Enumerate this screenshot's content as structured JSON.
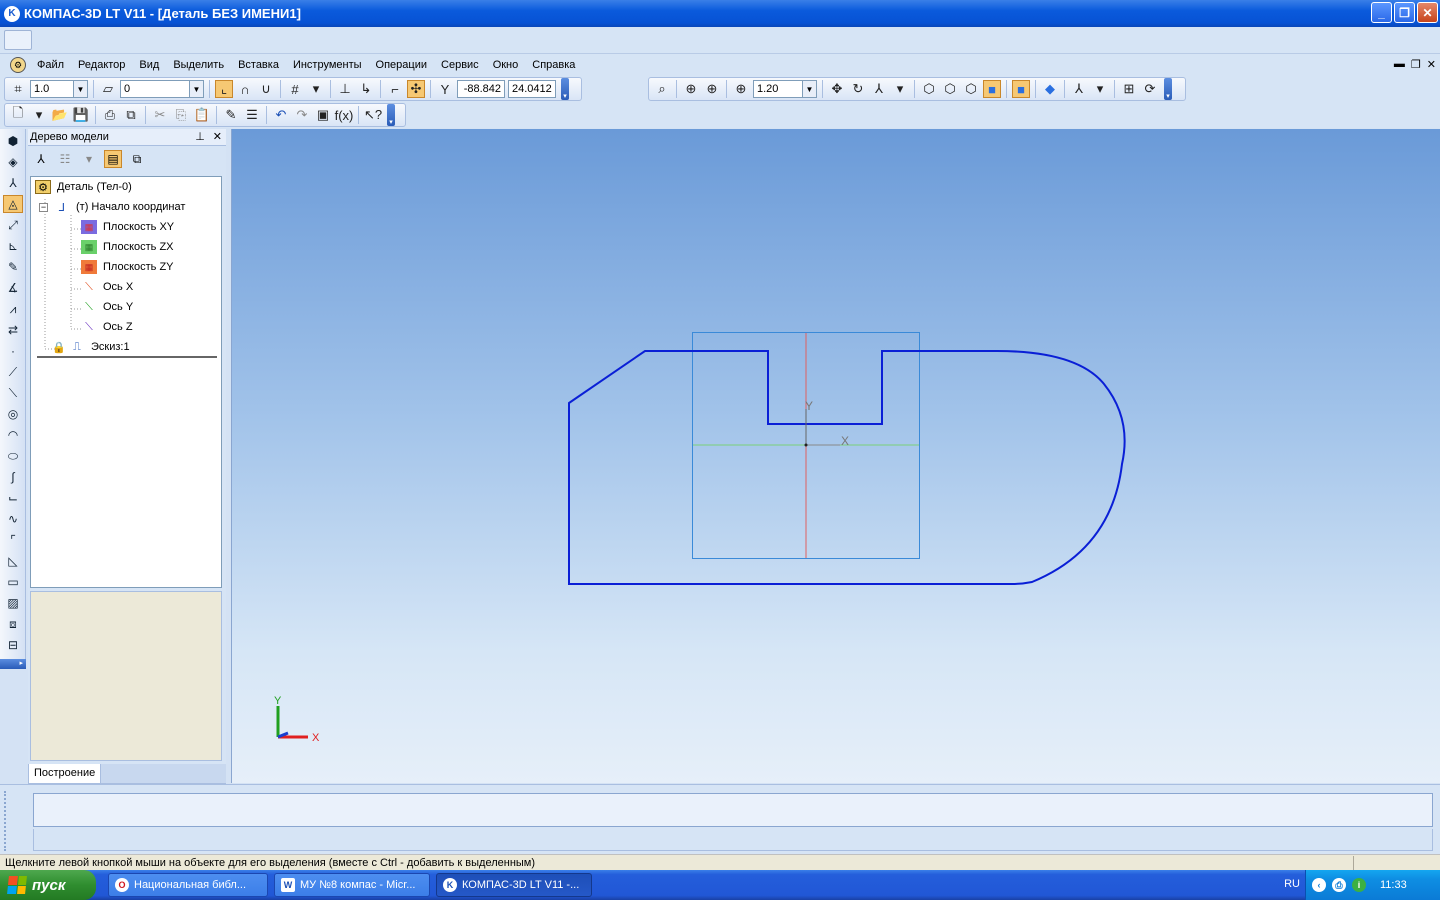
{
  "window": {
    "title": "КОМПАС-3D LT V11 - [Деталь БЕЗ ИМЕНИ1]",
    "app_icon": "kompas-icon"
  },
  "menu": {
    "items": [
      "Файл",
      "Редактор",
      "Вид",
      "Выделить",
      "Вставка",
      "Инструменты",
      "Операции",
      "Сервис",
      "Окно",
      "Справка"
    ]
  },
  "toolbar_current": {
    "step_value": "1.0",
    "layer_value": "0",
    "coord_x": "-88.842",
    "coord_y": "24.0412"
  },
  "toolbar_view": {
    "zoom_value": "1.20"
  },
  "tree": {
    "header": "Дерево модели",
    "root": "Деталь (Тел-0)",
    "origin": "(т) Начало координат",
    "items": [
      "Плоскость XY",
      "Плоскость ZX",
      "Плоскость ZY",
      "Ось X",
      "Ось Y",
      "Ось Z"
    ],
    "sketch": "Эскиз:1",
    "tab": "Построение"
  },
  "canvas": {
    "axis_x_label": "X",
    "axis_y_label": "Y",
    "sketch_color": "#0a1fd6"
  },
  "status": {
    "text": "Щелкните левой кнопкой мыши на объекте для его выделения (вместе с Ctrl - добавить к выделенным)"
  },
  "taskbar": {
    "start_label": "пуск",
    "tasks": [
      {
        "label": "Национальная библ...",
        "icon": "opera-icon"
      },
      {
        "label": "МУ №8 компас - Micr...",
        "icon": "word-icon"
      },
      {
        "label": "КОМПАС-3D LT V11 -...",
        "icon": "kompas-icon"
      }
    ],
    "lang": "RU",
    "clock": "11:33"
  }
}
